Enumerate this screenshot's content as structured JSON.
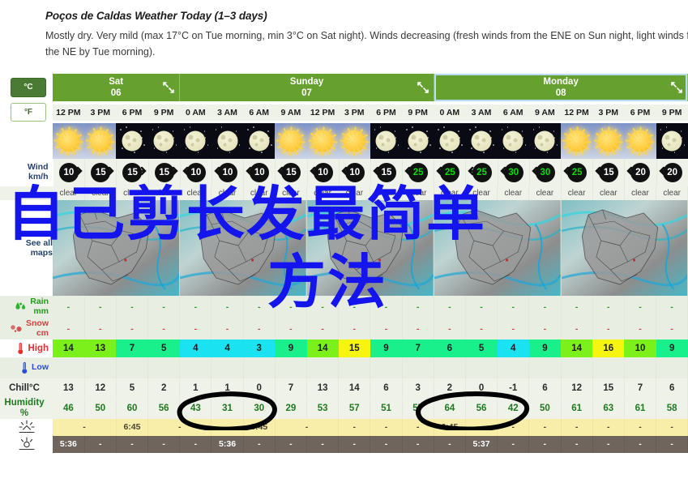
{
  "summary": {
    "title": "Poços de Caldas Weather Today (1–3 days)",
    "text": "Mostly dry. Very mild (max 17°C on Tue morning, min 3°C on Sat night). Winds decreasing (fresh winds from the ENE on Sun night, light winds from the NE by Tue morning)."
  },
  "units": {
    "celsius_label": "°C",
    "fahrenheit_label": "°F",
    "selected": "°C"
  },
  "row_labels": {
    "wind": "Wind",
    "wind_unit": "km/h",
    "see_all_maps": "See all\nmaps",
    "see_all_maps_line1": "See all",
    "see_all_maps_line2": "maps",
    "rain": "Rain",
    "rain_unit": "mm",
    "snow": "Snow",
    "snow_unit": "cm",
    "high": "High",
    "low": "Low",
    "chill": "Chill°C",
    "humidity": "Humidity",
    "humidity_unit": "%"
  },
  "days": [
    {
      "name": "Sat",
      "date": "06",
      "columns": 4,
      "selected": false
    },
    {
      "name": "Sunday",
      "date": "07",
      "columns": 8,
      "selected": false
    },
    {
      "name": "Monday",
      "date": "08",
      "columns": 8,
      "selected": true
    }
  ],
  "hours": [
    "12 PM",
    "3 PM",
    "6 PM",
    "9 PM",
    "0 AM",
    "3 AM",
    "6 AM",
    "9 AM",
    "12 PM",
    "3 PM",
    "6 PM",
    "9 PM",
    "0 AM",
    "3 AM",
    "6 AM",
    "9 AM",
    "12 PM",
    "3 PM",
    "6 PM",
    "9 PM"
  ],
  "day_start_indices": [
    0,
    4,
    12
  ],
  "sky": [
    "day",
    "day",
    "night",
    "night",
    "night",
    "night",
    "night",
    "day",
    "day",
    "day",
    "night",
    "night",
    "night",
    "night",
    "night",
    "night",
    "day",
    "day",
    "day",
    "night"
  ],
  "wind": {
    "speeds": [
      10,
      15,
      15,
      15,
      10,
      10,
      10,
      15,
      10,
      10,
      15,
      25,
      25,
      25,
      30,
      30,
      25,
      15,
      20,
      20
    ],
    "directions": [
      "E",
      "ENE",
      "NE",
      "NE",
      "ENE",
      "ENE",
      "ENE",
      "E",
      "ENE",
      "ENE",
      "E",
      "ENE",
      "ENE",
      "ENE",
      "ENE",
      "ENE",
      "ENE",
      "ENE",
      "ENE",
      "ENE"
    ]
  },
  "descriptions": [
    "clear",
    "clear",
    "clear",
    "clear",
    "clear",
    "clear",
    "clear",
    "clear",
    "clear",
    "clear",
    "clear",
    "clear",
    "clear",
    "clear",
    "clear",
    "clear",
    "clear",
    "clear",
    "clear",
    "clear"
  ],
  "rain": [
    "-",
    "-",
    "-",
    "-",
    "-",
    "-",
    "-",
    "-",
    "-",
    "-",
    "-",
    "-",
    "-",
    "-",
    "-",
    "-",
    "-",
    "-",
    "-",
    "-"
  ],
  "snow": [
    "-",
    "-",
    "-",
    "-",
    "-",
    "-",
    "-",
    "-",
    "-",
    "-",
    "-",
    "-",
    "-",
    "-",
    "-",
    "-",
    "-",
    "-",
    "-",
    "-"
  ],
  "high": {
    "values": [
      14,
      13,
      7,
      5,
      4,
      4,
      3,
      9,
      14,
      15,
      9,
      7,
      6,
      5,
      4,
      9,
      14,
      16,
      10,
      9
    ],
    "colors": [
      "#7cf01a",
      "#7cf01a",
      "#19f08c",
      "#19f08c",
      "#1ae2f0",
      "#1ae2f0",
      "#1ae2f0",
      "#19f08c",
      "#7cf01a",
      "#f5f510",
      "#19f08c",
      "#19f08c",
      "#19f08c",
      "#19f08c",
      "#1ae2f0",
      "#19f08c",
      "#7cf01a",
      "#f5f510",
      "#7cf01a",
      "#19f08c"
    ]
  },
  "low": [
    "",
    "",
    "",
    "",
    "",
    "",
    "",
    "",
    "",
    "",
    "",
    "",
    "",
    "",
    "",
    "",
    "",
    "",
    "",
    ""
  ],
  "chill": [
    13,
    12,
    5,
    2,
    1,
    1,
    0,
    7,
    13,
    14,
    6,
    3,
    2,
    0,
    -1,
    6,
    12,
    15,
    7,
    6
  ],
  "humidity": [
    46,
    50,
    60,
    56,
    43,
    31,
    30,
    29,
    53,
    57,
    51,
    57,
    64,
    56,
    42,
    50,
    61,
    63,
    61,
    58
  ],
  "sunrise": [
    "-",
    "-",
    "6:45",
    "-",
    "-",
    "-",
    "-",
    "-",
    "-",
    "-",
    "-",
    "-",
    "6:45",
    "-",
    "-",
    "-",
    "-",
    "-",
    "-",
    "-"
  ],
  "sunset": [
    "5:36",
    "-",
    "-",
    "-",
    "-",
    "5:36",
    "-",
    "-",
    "-",
    "-",
    "-",
    "-",
    "-",
    "5:37",
    "-",
    "-",
    "-",
    "-",
    "-",
    "-"
  ],
  "sunrise_spans": [
    {
      "start": 0,
      "span": 2,
      "value": "-"
    },
    {
      "start": 2,
      "span": 1,
      "value": "6:45"
    },
    {
      "start": 3,
      "span": 2,
      "value": "-"
    },
    {
      "start": 5,
      "span": 1,
      "value": "-"
    },
    {
      "start": 6,
      "span": 1,
      "value": "6:45"
    },
    {
      "start": 7,
      "span": 2,
      "value": "-"
    }
  ],
  "annotations": {
    "ellipse_1": "circles Sunday chill values 1, 1, 0",
    "ellipse_2": "circles Monday chill values 2, 0, -1"
  },
  "overlay_text": {
    "line1": "自己剪长发最简单",
    "line2": "方法"
  },
  "colors": {
    "header_green": "#66a02e",
    "selected_outline": "#b8dcf5",
    "grid_bg": "#eef2e9",
    "sunrise_bg": "#f8eeaa",
    "sunset_bg": "#6f655c",
    "overlay_blue": "#1414ee",
    "label_blue": "#25436d"
  }
}
